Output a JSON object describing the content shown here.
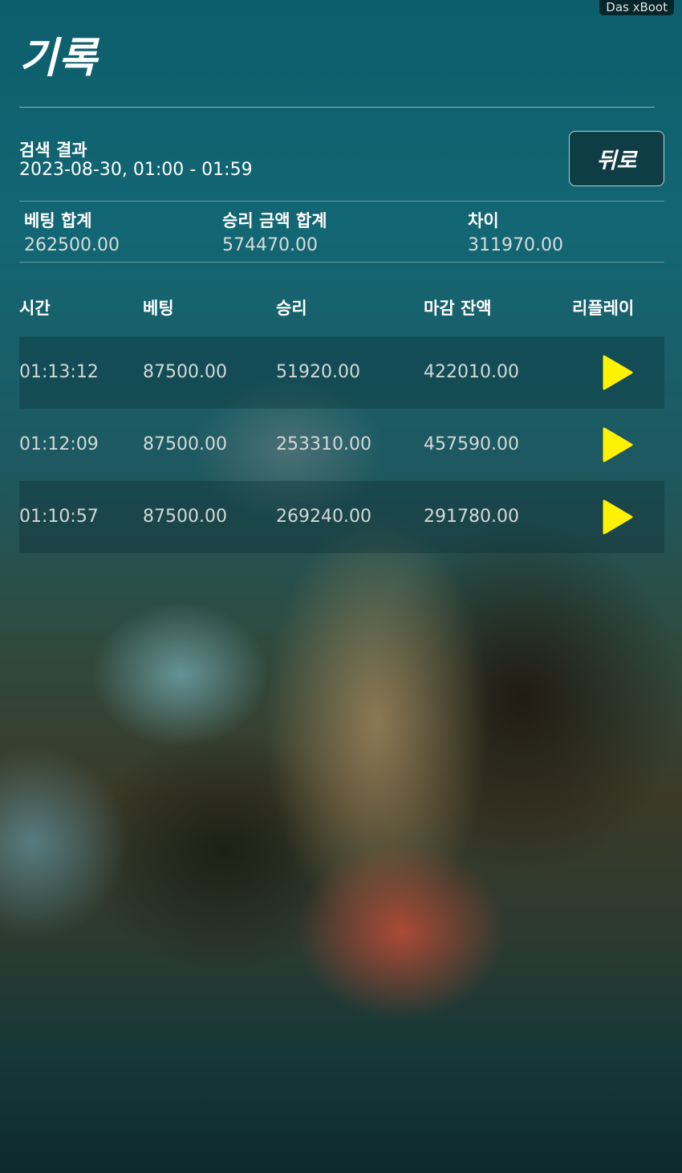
{
  "watermark": "Das xBoot",
  "page_title": "기록",
  "search": {
    "label": "검색 결과",
    "range": "2023-08-30, 01:00 - 01:59"
  },
  "back_button_label": "뒤로",
  "summary": {
    "bet_total_label": "베팅 합계",
    "bet_total_value": "262500.00",
    "win_total_label": "승리 금액 합계",
    "win_total_value": "574470.00",
    "diff_label": "차이",
    "diff_value": "311970.00"
  },
  "columns": [
    "시간",
    "베팅",
    "승리",
    "마감 잔액",
    "리플레이"
  ],
  "rows": [
    {
      "time": "01:13:12",
      "bet": "87500.00",
      "win": "51920.00",
      "balance": "422010.00"
    },
    {
      "time": "01:12:09",
      "bet": "87500.00",
      "win": "253310.00",
      "balance": "457590.00"
    },
    {
      "time": "01:10:57",
      "bet": "87500.00",
      "win": "269240.00",
      "balance": "291780.00"
    }
  ],
  "icons": {
    "replay": "play-icon"
  },
  "colors": {
    "play_icon": "#fff200",
    "back_button_bg": "#0f3d45"
  }
}
